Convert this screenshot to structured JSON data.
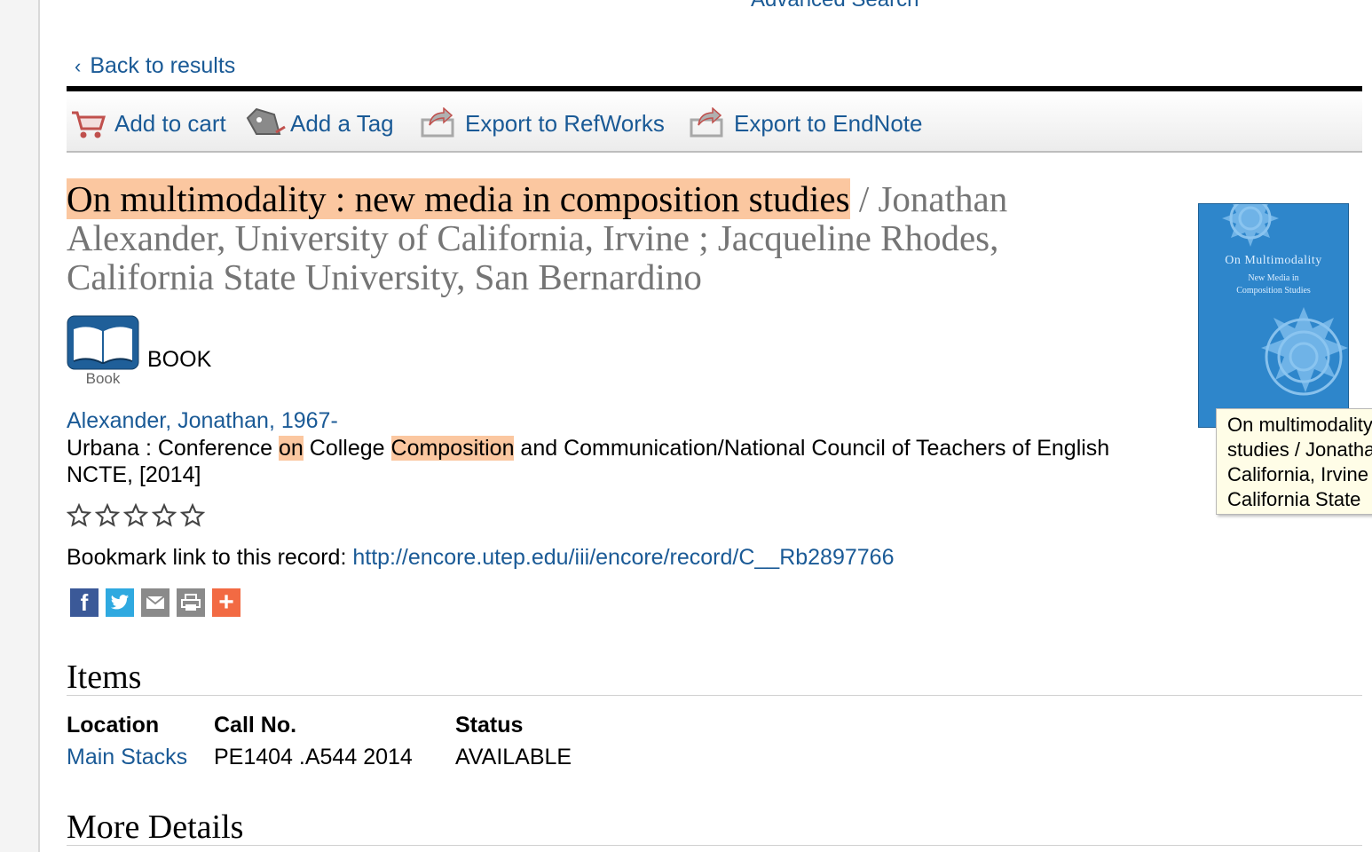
{
  "header": {
    "advanced_search": "Advanced Search"
  },
  "nav": {
    "back_label": "Back to results"
  },
  "toolbar": {
    "add_to_cart": "Add to cart",
    "add_tag": "Add a Tag",
    "export_refworks": "Export to RefWorks",
    "export_endnote": "Export to EndNote"
  },
  "record": {
    "title": "On multimodality : new media in composition studies",
    "responsibility": " / Jonathan Alexander, University of California, Irvine ; Jacqueline Rhodes, California State University, San Bernardino",
    "type_icon_caption": "Book",
    "type_label": "BOOK",
    "author": "Alexander, Jonathan, 1967-",
    "pub_part1": "Urbana : Conference ",
    "pub_hl1": "on",
    "pub_part2": " College ",
    "pub_hl2": "Composition",
    "pub_part3": " and Communication/National Council of Teachers of English",
    "pub_line2": "NCTE, [2014]",
    "rating": 0,
    "bookmark_label": "Bookmark link to this record: ",
    "bookmark_url": "http://encore.utep.edu/iii/encore/record/C__Rb2897766"
  },
  "cover": {
    "title": "On Multimodality",
    "subtitle_1": "New Media in",
    "subtitle_2": "Composition Studies",
    "tooltip": [
      "On multimodality",
      "studies / Jonathan",
      "California, Irvine",
      "California State"
    ]
  },
  "items": {
    "heading": "Items",
    "headers": {
      "location": "Location",
      "call_no": "Call No.",
      "status": "Status"
    },
    "rows": [
      {
        "location": "Main Stacks",
        "call_no": "PE1404 .A544 2014",
        "status": "AVAILABLE"
      }
    ]
  },
  "more_details": {
    "heading": "More Details"
  },
  "colors": {
    "link": "#1a5a96",
    "highlight": "#fbc7a0",
    "cover": "#2e86cb"
  }
}
